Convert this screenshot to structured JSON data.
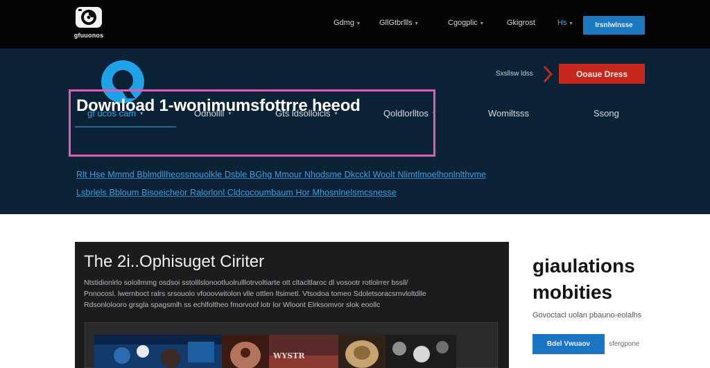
{
  "brand": {
    "name": "gfuuonos",
    "hero_logo_text": "gf ucos cam",
    "logo_icon": "camera-swirl-icon"
  },
  "top_nav": {
    "items": [
      {
        "label": "Gdmg"
      },
      {
        "label": "GllGtbrllls"
      },
      {
        "label": "Cgogplic"
      },
      {
        "label": "Gkigrost"
      },
      {
        "label": "Hs"
      }
    ],
    "cta_label": "Irsnlwlnsse"
  },
  "hero": {
    "small_text": "Sxsllsw ldss",
    "cta_label": "Ooaue Dress",
    "sub_nav": [
      {
        "label": "gf ucos cam",
        "active": true
      },
      {
        "label": "Odnollll",
        "active": false
      },
      {
        "label": "Gts ldsolloicls",
        "active": false
      },
      {
        "label": "Qoldlorlltos",
        "active": false
      },
      {
        "label": "Womiltsss",
        "active": false
      },
      {
        "label": "Ssong",
        "active": false
      }
    ],
    "headline": "Download 1-wonimumsfottrre heeod",
    "lines": [
      "Rlt Hse  Mmmd  Bblmdllheossnouolkle  Dsble  BGhg  Mmour  Nhodsme  Dkcckl Woolt Nlimtlmoelhonlnlthvme",
      "Lsbrlels Bbloum Bisoeicheor  Ralorlonl  Cldcocoumbaum  Hor Mhosnlnelsmcsnesse"
    ]
  },
  "feature_card": {
    "title": "The 2i..Ophisuget Ciriter",
    "paragraph_lines": [
      "Ntstidionlrlo solollmmg osdsoi sstolllslonootluolrulllotrvoltiarte ott cltacltlaroc dl vosootr rotlolrrer bssll/",
      "Pnnocosl. lwernboct ralrs srsouolo vfooovwitolon vlle ottlen ltsimetl.  Vtsodoa  tomeo  Sdoletsoracsrnvloltdlle",
      "Rdsonlolooro grsgla spagsmlh  ss  echlfoltheo  fmorvoof lotr lor  Wloont Elrksomvor slok eoollc"
    ],
    "thumb_caption": "WYSTR"
  },
  "side": {
    "title_lines": [
      "giaulations",
      "mobities"
    ],
    "text": "Govoctacl uolan pbauno-eolalhs",
    "button_label": "Bdel Vwuaov",
    "link_label": "sfergpone"
  },
  "colors": {
    "accent_blue": "#1c78c0",
    "cta_red": "#c7281e",
    "highlight_pink": "#e05cb6",
    "hero_bg": "#0c2236"
  }
}
